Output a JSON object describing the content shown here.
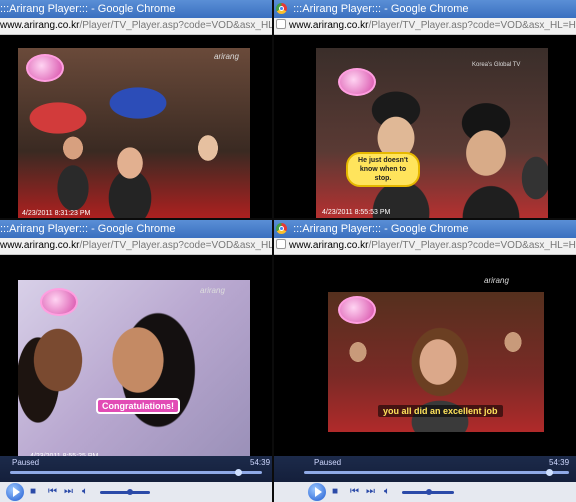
{
  "windows": [
    {
      "title": ":::Arirang Player::: - Google Chrome",
      "url_domain": "www.arirang.co.kr",
      "url_path": "/Player/TV_Player.asp?code=VOD&asx_HL=High&Prog_C",
      "timestamp": "4/23/2011 8:31:23 PM",
      "channel_logo": "arirang",
      "caption": ""
    },
    {
      "title": ":::Arirang Player::: - Google Chrome",
      "url_domain": "www.arirang.co.kr",
      "url_path": "/Player/TV_Player.asp?code=VOD&asx_HL=High&Prog_C",
      "timestamp": "4/23/2011 8:55:53 PM",
      "channel_logo": "Korea's Global TV",
      "caption": "He just doesn't know when to stop."
    },
    {
      "title": ":::Arirang Player::: - Google Chrome",
      "url_domain": "www.arirang.co.kr",
      "url_path": "/Player/TV_Player.asp?code=VOD&asx_HL=High&Prog_C",
      "timestamp": "4/23/2011 8:55:25 PM",
      "channel_logo": "arirang",
      "caption": "Congratulations!",
      "player": {
        "status": "Paused",
        "duration": "54:39",
        "seek_progress": 0.9,
        "volume_level": 0.55
      }
    },
    {
      "title": ":::Arirang Player::: - Google Chrome",
      "url_domain": "www.arirang.co.kr",
      "url_path": "/Player/TV_Player.asp?code=VOD&asx_HL=High&Prog_C",
      "timestamp": "",
      "channel_logo": "arirang",
      "caption": "you all did an excellent job",
      "player": {
        "status": "Paused",
        "duration": "54:39",
        "seek_progress": 0.92,
        "volume_level": 0.5
      }
    }
  ],
  "colors": {
    "titlebar": "#3a6fbf",
    "caption_yellow": "#ffe45c",
    "caption_pink": "#e24bb5"
  },
  "icons": [
    "chrome-icon",
    "page-icon",
    "play-icon",
    "stop-icon",
    "prev-icon",
    "next-icon",
    "volume-icon"
  ]
}
